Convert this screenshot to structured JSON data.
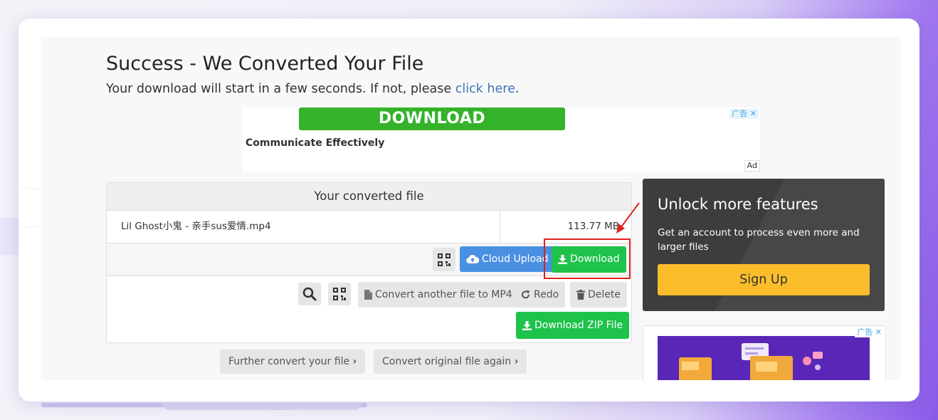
{
  "page": {
    "title": "Success - We Converted Your File",
    "subtitle_prefix": "Your download will start in a few seconds. If not, please ",
    "subtitle_link": "click here",
    "subtitle_suffix": "."
  },
  "ad_banner": {
    "button_label": "DOWNLOAD",
    "text": "Communicate Effectively",
    "close_label": "广告 ✕",
    "ad_label": "Ad"
  },
  "converted_panel": {
    "heading": "Your converted file",
    "file_name": "Lil Ghost小鬼 - 亲手sus爱情.mp4",
    "file_size": "113.77 MB",
    "cloud_upload_label": "Cloud Upload",
    "download_label": "Download",
    "convert_another_label": "Convert another file to MP4",
    "redo_label": "Redo",
    "delete_label": "Delete",
    "download_zip_label": "Download ZIP File"
  },
  "further_actions": {
    "further_convert_label": "Further convert your file",
    "convert_original_label": "Convert original file again",
    "chevron": "›"
  },
  "unlock_box": {
    "heading": "Unlock more features",
    "description": "Get an account to process even more and larger files",
    "signup_label": "Sign Up"
  },
  "side_ad": {
    "close_label": "广告 ✕"
  },
  "colors": {
    "green": "#1fc24b",
    "blue": "#4a90e2",
    "yellow": "#fbbd2b",
    "dark": "#3d3d3d",
    "highlight": "#e02020",
    "link": "#3f73b8"
  },
  "icons": {
    "search": "search-icon",
    "qr": "qr-code-icon",
    "cloud": "cloud-upload-icon",
    "download": "download-icon",
    "file": "file-icon",
    "redo": "redo-icon",
    "trash": "trash-icon"
  }
}
